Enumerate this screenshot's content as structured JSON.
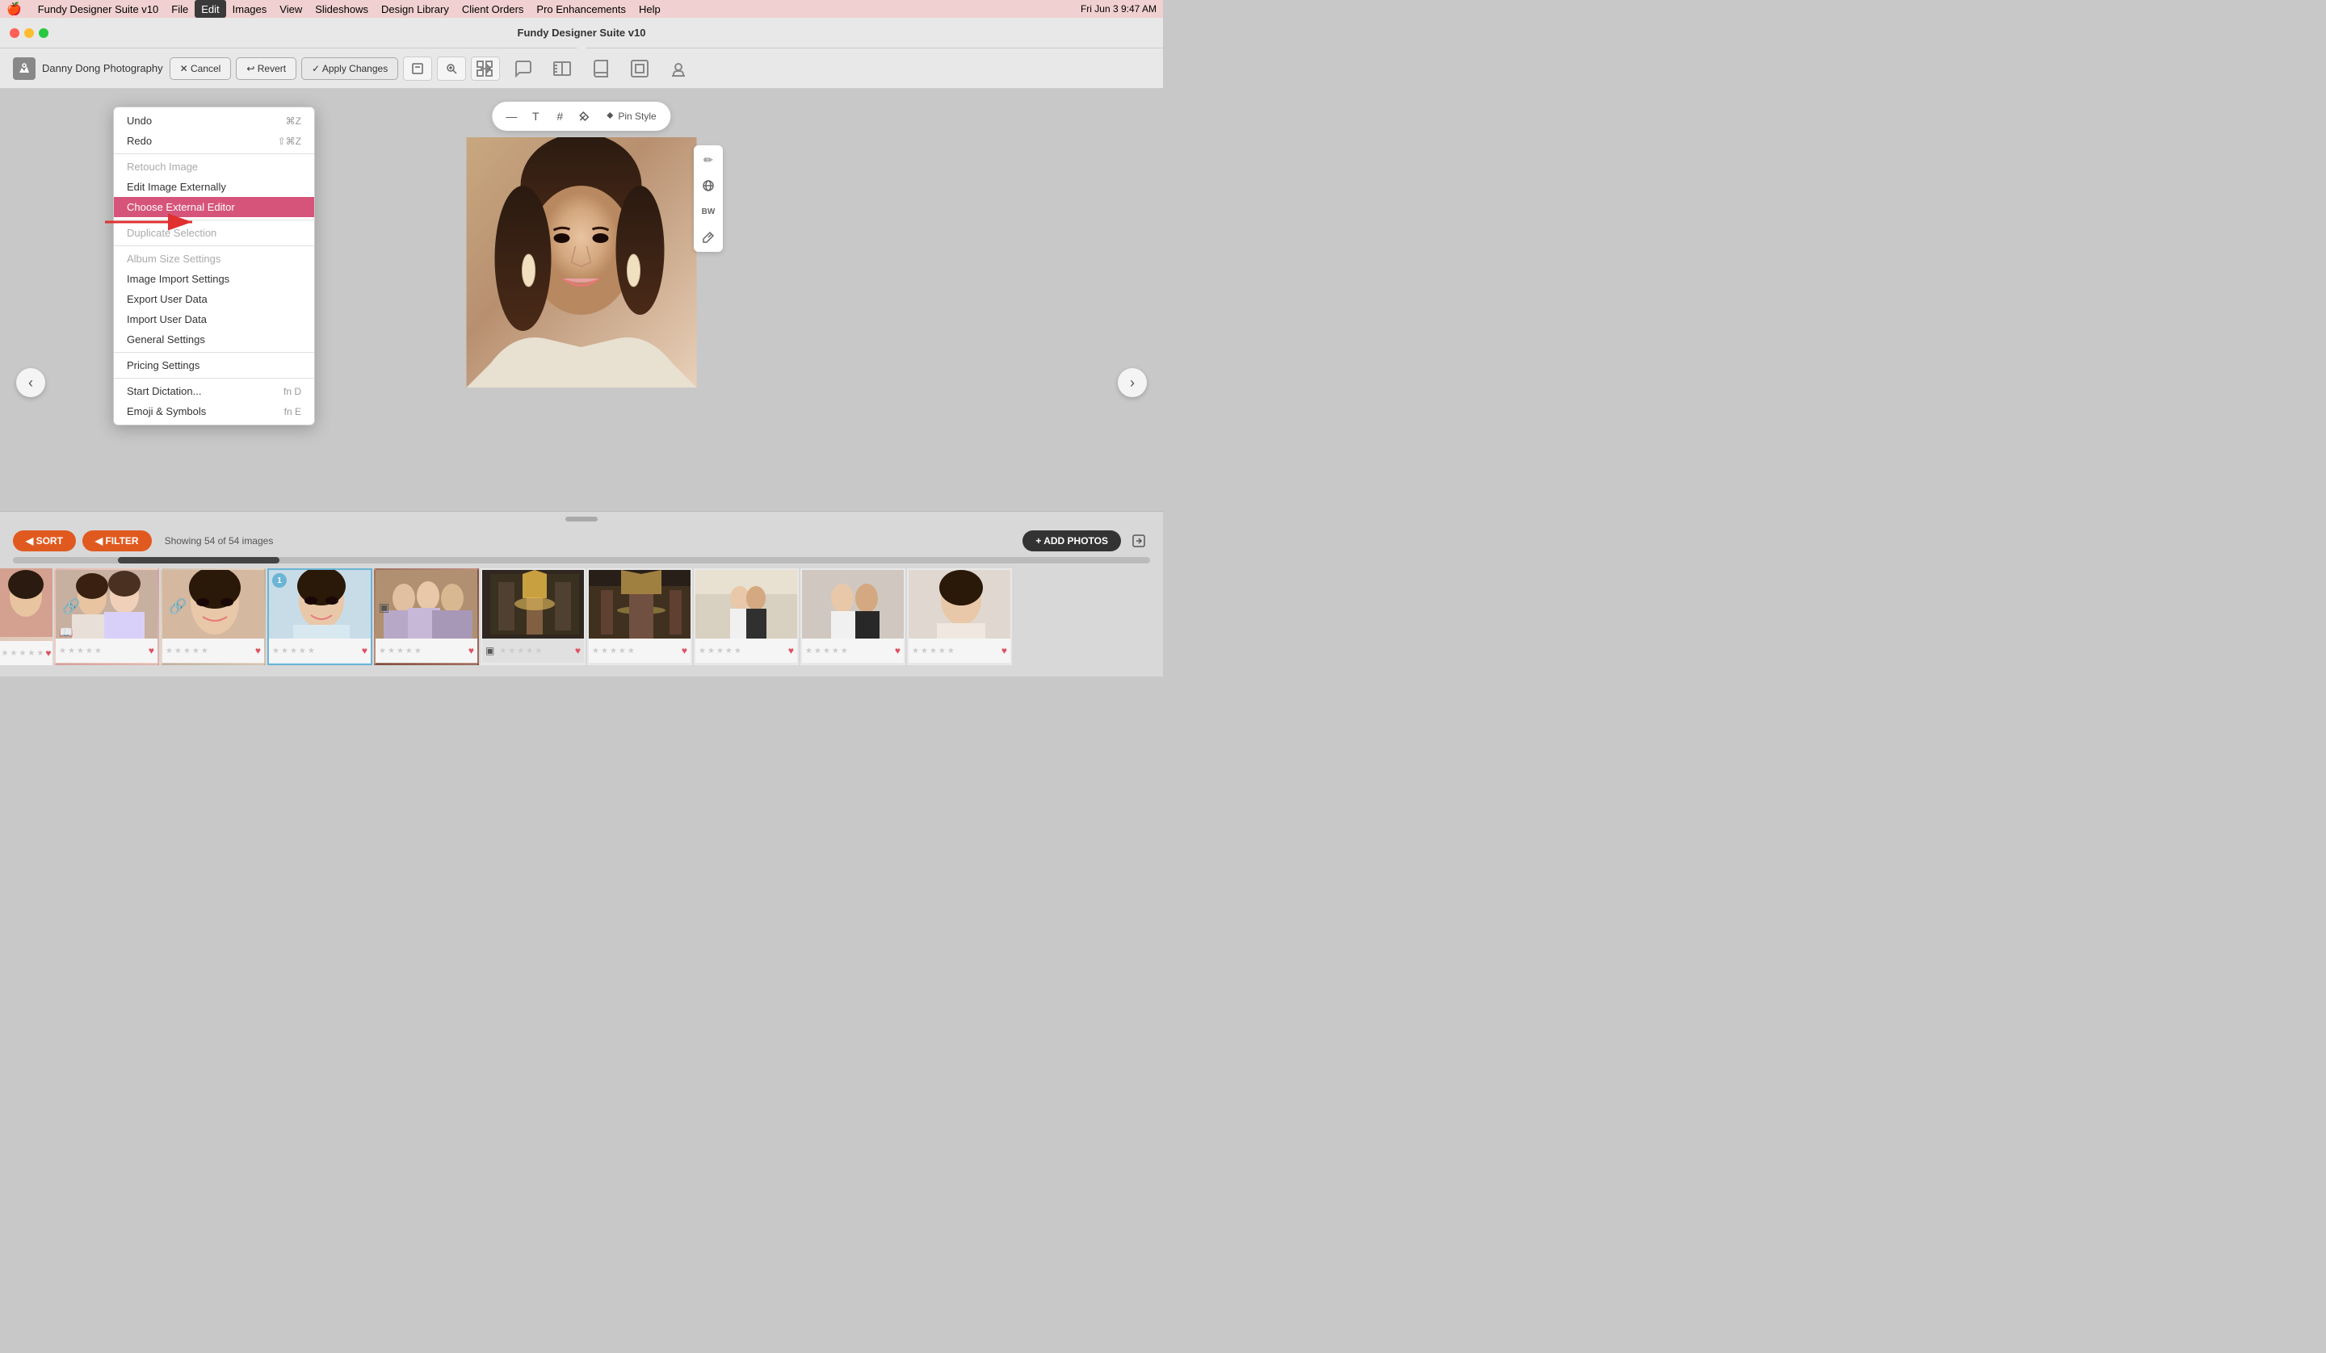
{
  "app": {
    "name": "Fundy Designer Suite v10",
    "title": "Fundy Designer Suite v10"
  },
  "menubar": {
    "apple": "🍎",
    "items": [
      {
        "label": "Fundy Designer Suite v10",
        "active": false
      },
      {
        "label": "File",
        "active": false
      },
      {
        "label": "Edit",
        "active": true
      },
      {
        "label": "Images",
        "active": false
      },
      {
        "label": "View",
        "active": false
      },
      {
        "label": "Slideshows",
        "active": false
      },
      {
        "label": "Design Library",
        "active": false
      },
      {
        "label": "Client Orders",
        "active": false
      },
      {
        "label": "Pro Enhancements",
        "active": false
      },
      {
        "label": "Help",
        "active": false
      }
    ],
    "right": {
      "time": "Fri Jun 3  9:47 AM"
    }
  },
  "studio": {
    "name": "Danny Dong Photography"
  },
  "toolbar_buttons": {
    "cancel": "✕ Cancel",
    "revert": "↩ Revert",
    "apply": "✓ Apply Changes"
  },
  "edit_menu": {
    "items": [
      {
        "id": "undo",
        "label": "Undo",
        "shortcut": "⌘Z",
        "disabled": false
      },
      {
        "id": "redo",
        "label": "Redo",
        "shortcut": "⇧⌘Z",
        "disabled": false
      },
      {
        "id": "sep1",
        "type": "separator"
      },
      {
        "id": "retouch",
        "label": "Retouch Image",
        "disabled": true
      },
      {
        "id": "edit-external",
        "label": "Edit Image Externally",
        "disabled": false
      },
      {
        "id": "choose-editor",
        "label": "Choose External Editor",
        "highlighted": true,
        "disabled": false
      },
      {
        "id": "sep2",
        "type": "separator"
      },
      {
        "id": "duplicate",
        "label": "Duplicate Selection",
        "disabled": true
      },
      {
        "id": "sep3",
        "type": "separator"
      },
      {
        "id": "album-size",
        "label": "Album Size Settings",
        "disabled": true
      },
      {
        "id": "image-import",
        "label": "Image Import Settings",
        "disabled": false
      },
      {
        "id": "export-user",
        "label": "Export User Data",
        "disabled": false
      },
      {
        "id": "import-user",
        "label": "Import User Data",
        "disabled": false
      },
      {
        "id": "general",
        "label": "General Settings",
        "disabled": false
      },
      {
        "id": "sep4",
        "type": "separator"
      },
      {
        "id": "pricing",
        "label": "Pricing Settings",
        "disabled": false
      },
      {
        "id": "sep5",
        "type": "separator"
      },
      {
        "id": "dictation",
        "label": "Start Dictation...",
        "shortcut": "fn D",
        "disabled": false
      },
      {
        "id": "emoji",
        "label": "Emoji & Symbols",
        "shortcut": "fn E",
        "disabled": false
      }
    ]
  },
  "edit_toolbar": {
    "minus": "—",
    "text": "T",
    "hash": "#",
    "tool": "🔧",
    "pin": "📌",
    "pin_label": "Pin Style"
  },
  "side_tools": {
    "pencil": "✏",
    "globe": "🌐",
    "bw": "BW",
    "eyedropper": "💉"
  },
  "nav_arrows": {
    "left": "‹",
    "right": "›"
  },
  "bottom_panel": {
    "sort_label": "◀ SORT",
    "filter_label": "◀ FILTER",
    "showing_text": "Showing 54 of 54 images",
    "add_photos": "+ ADD PHOTOS"
  },
  "thumbnails": [
    {
      "id": 1,
      "bg": "thumb-bg-1",
      "selected": false,
      "link": true,
      "book": true,
      "stars": 0,
      "heart": true
    },
    {
      "id": 2,
      "bg": "thumb-bg-1",
      "selected": false,
      "link": true,
      "book": false,
      "stars": 0,
      "heart": true
    },
    {
      "id": 3,
      "bg": "thumb-bg-2",
      "selected": false,
      "link": true,
      "book": false,
      "stars": 0,
      "heart": true
    },
    {
      "id": 4,
      "bg": "thumb-bg-3",
      "selected": true,
      "badge": "1",
      "link": false,
      "book": false,
      "stars": 0,
      "heart": true
    },
    {
      "id": 5,
      "bg": "thumb-bg-4",
      "selected": false,
      "link": false,
      "book": false,
      "stars": 0,
      "heart": true,
      "square": true
    },
    {
      "id": 6,
      "bg": "thumb-bg-5",
      "selected": false,
      "link": false,
      "book": false,
      "stars": 0,
      "heart": true,
      "square": true
    },
    {
      "id": 7,
      "bg": "thumb-bg-6",
      "selected": false,
      "link": false,
      "book": false,
      "stars": 0,
      "heart": true
    },
    {
      "id": 8,
      "bg": "thumb-bg-7",
      "selected": false,
      "link": false,
      "book": false,
      "stars": 0,
      "heart": true
    },
    {
      "id": 9,
      "bg": "thumb-bg-8",
      "selected": false,
      "link": false,
      "book": false,
      "stars": 0,
      "heart": true
    },
    {
      "id": 10,
      "bg": "thumb-bg-9",
      "selected": false,
      "link": false,
      "book": false,
      "stars": 0,
      "heart": true
    }
  ]
}
